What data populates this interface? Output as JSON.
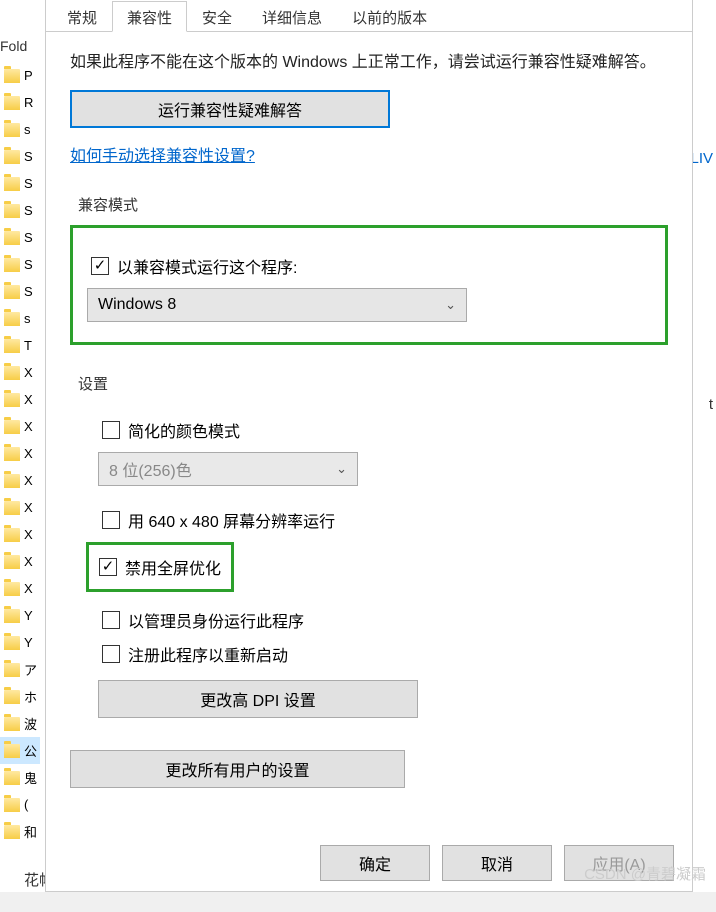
{
  "bg": {
    "folder_header": "Fold",
    "items": [
      "P",
      "R",
      "s",
      "S",
      "S",
      "S",
      "S",
      "S",
      "S",
      "s",
      "T",
      "X",
      "X",
      "X",
      "X",
      "X",
      "X",
      "X",
      "X",
      "X",
      "Y",
      "Y",
      "ア",
      "ホ",
      "波",
      "公",
      "鬼",
      "(",
      "和"
    ],
    "selected_index": 25,
    "right_link": "LIV",
    "right_text": "t",
    "bottom_text": "花帕absolute"
  },
  "tabs": {
    "items": [
      "常规",
      "兼容性",
      "安全",
      "详细信息",
      "以前的版本"
    ],
    "active_index": 1
  },
  "intro": "如果此程序不能在这个版本的 Windows 上正常工作，请尝试运行兼容性疑难解答。",
  "buttons": {
    "troubleshoot": "运行兼容性疑难解答",
    "help_link": "如何手动选择兼容性设置?",
    "dpi": "更改高 DPI 设置",
    "all_users": "更改所有用户的设置",
    "ok": "确定",
    "cancel": "取消",
    "apply": "应用(A)"
  },
  "compat": {
    "legend": "兼容模式",
    "checkbox_label": "以兼容模式运行这个程序:",
    "checked": true,
    "selected_os": "Windows 8"
  },
  "settings": {
    "legend": "设置",
    "reduced_color": {
      "label": "简化的颜色模式",
      "checked": false
    },
    "color_select": "8 位(256)色",
    "run_640": {
      "label": "用 640 x 480 屏幕分辨率运行",
      "checked": false
    },
    "disable_fullscreen": {
      "label": "禁用全屏优化",
      "checked": true
    },
    "run_admin": {
      "label": "以管理员身份运行此程序",
      "checked": false
    },
    "register_restart": {
      "label": "注册此程序以重新启动",
      "checked": false
    }
  },
  "watermark": "CSDN @青碧凝霜"
}
